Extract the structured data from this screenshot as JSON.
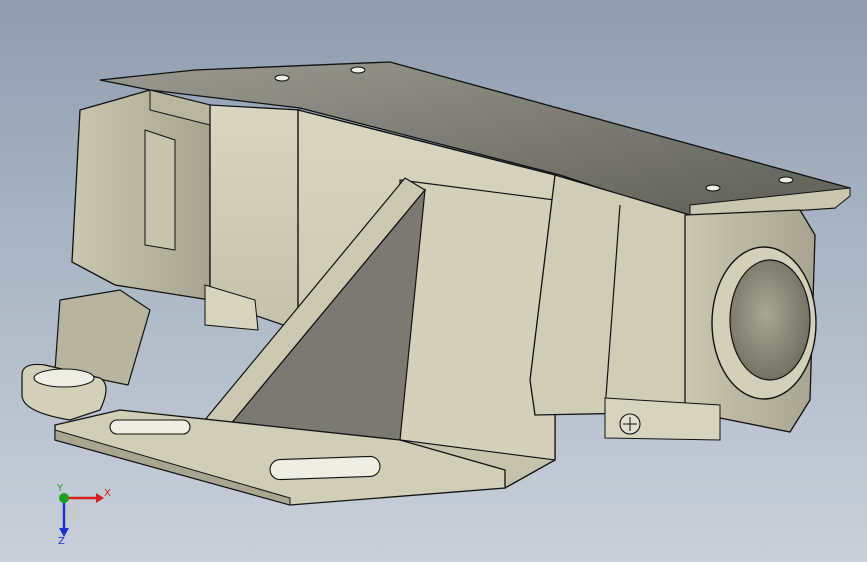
{
  "viewport": {
    "background_top": "#8f9db0",
    "background_bottom": "#c9d0da",
    "model_color": "#d2d0b8",
    "model_shade": "#a9a892",
    "model_dark": "#6b6b63",
    "edge_color": "#111111"
  },
  "triad": {
    "x_label": "X",
    "y_label": "Y",
    "z_label": "Z",
    "x_color": "#d62020",
    "y_color": "#1ea21e",
    "z_color": "#2030c8"
  }
}
